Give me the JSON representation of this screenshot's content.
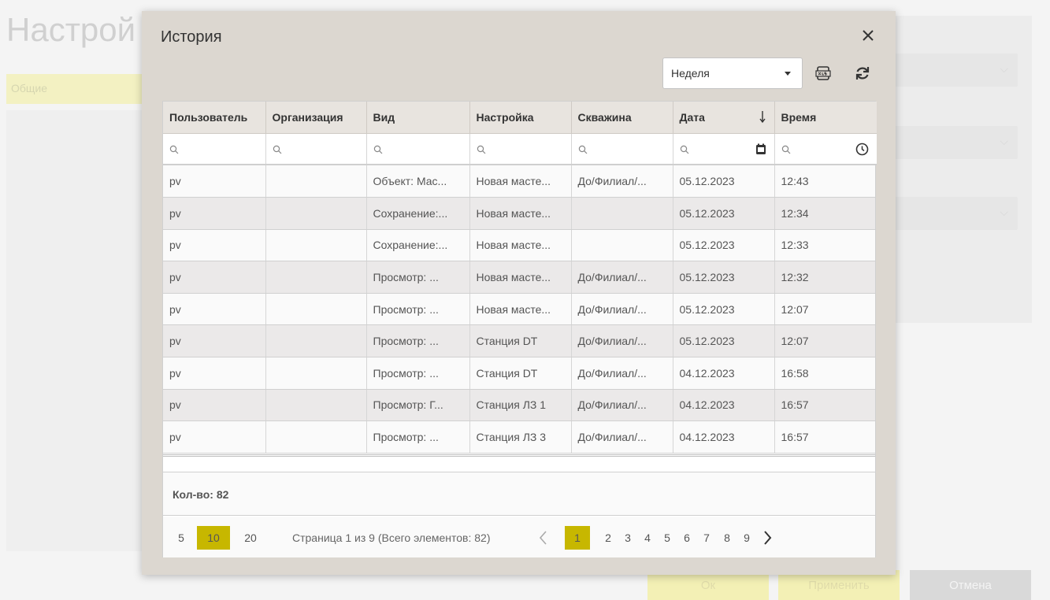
{
  "background": {
    "title": "Настрой",
    "tab": "Общие",
    "buttons": {
      "ok": "Ок",
      "apply": "Применить",
      "cancel": "Отмена"
    }
  },
  "modal": {
    "title": "История",
    "period": "Неделя",
    "columns": [
      "Пользователь",
      "Организация",
      "Вид",
      "Настройка",
      "Скважина",
      "Дата",
      "Время"
    ],
    "rows": [
      [
        "pv",
        "",
        "Объект: Мас...",
        "Новая масте...",
        "До/Филиал/...",
        "05.12.2023",
        "12:43"
      ],
      [
        "pv",
        "",
        "Сохранение:...",
        "Новая масте...",
        "",
        "05.12.2023",
        "12:34"
      ],
      [
        "pv",
        "",
        "Сохранение:...",
        "Новая масте...",
        "",
        "05.12.2023",
        "12:33"
      ],
      [
        "pv",
        "",
        "Просмотр: ...",
        "Новая масте...",
        "До/Филиал/...",
        "05.12.2023",
        "12:32"
      ],
      [
        "pv",
        "",
        "Просмотр: ...",
        "Новая масте...",
        "До/Филиал/...",
        "05.12.2023",
        "12:07"
      ],
      [
        "pv",
        "",
        "Просмотр: ...",
        "Станция DT",
        "До/Филиал/...",
        "05.12.2023",
        "12:07"
      ],
      [
        "pv",
        "",
        "Просмотр: ...",
        "Станция DT",
        "До/Филиал/...",
        "04.12.2023",
        "16:58"
      ],
      [
        "pv",
        "",
        "Просмотр: Г...",
        "Станция ЛЗ 1",
        "До/Филиал/...",
        "04.12.2023",
        "16:57"
      ],
      [
        "pv",
        "",
        "Просмотр: ...",
        "Станция ЛЗ 3",
        "До/Филиал/...",
        "04.12.2023",
        "16:57"
      ]
    ],
    "count_label": "Кол-во: 82",
    "pager": {
      "page_sizes": [
        "5",
        "10",
        "20"
      ],
      "active_page_size": "10",
      "info": "Страница 1 из 9 (Всего элементов: 82)",
      "pages": [
        "1",
        "2",
        "3",
        "4",
        "5",
        "6",
        "7",
        "8",
        "9"
      ],
      "active_page": "1"
    }
  },
  "colors": {
    "accent": "#c7b700",
    "modal_bg": "#dcd7d0",
    "header_bg": "#e8e4df"
  }
}
